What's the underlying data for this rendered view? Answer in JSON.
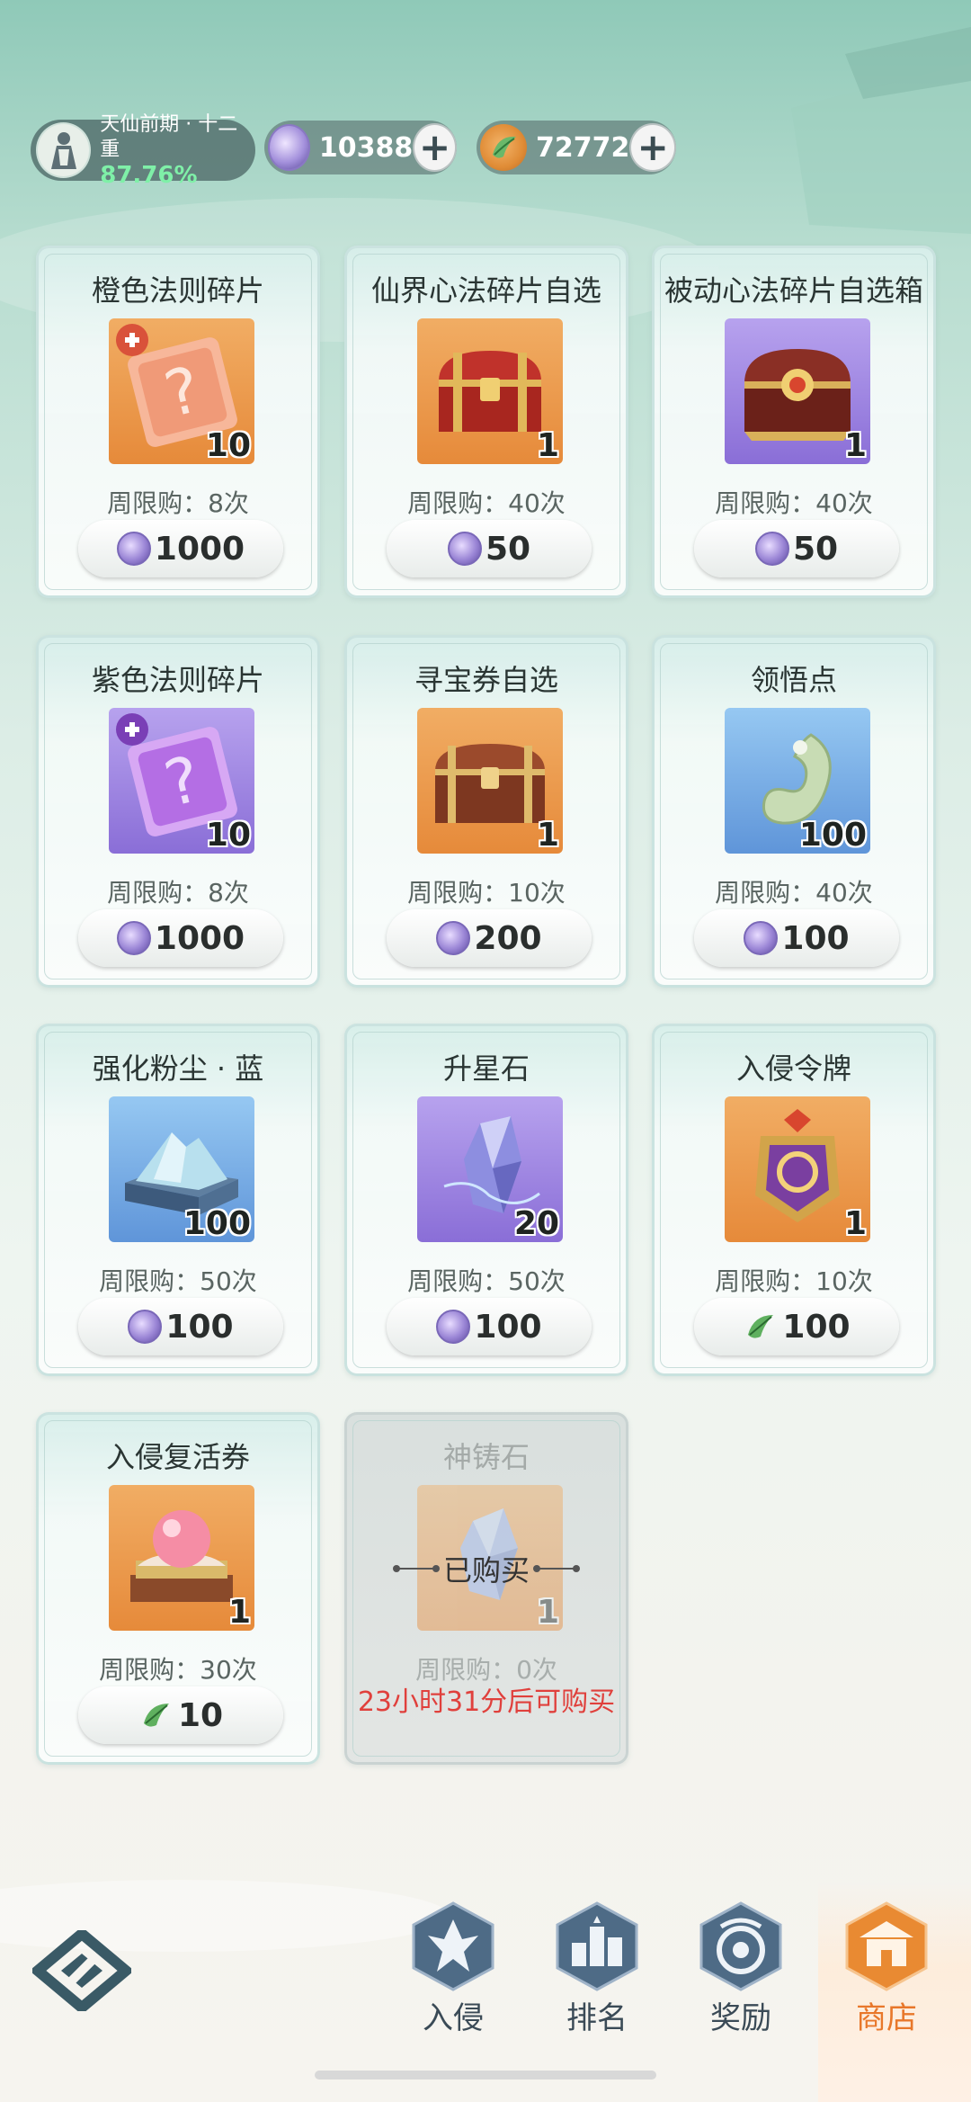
{
  "header": {
    "realm_name": "天仙前期 · 十二重",
    "realm_progress": "87.76%",
    "currencies": [
      {
        "icon": "spirit-gem-icon",
        "value": "10388"
      },
      {
        "icon": "jade-leaf-icon",
        "value": "72772"
      }
    ]
  },
  "items": [
    {
      "name": "橙色法则碎片",
      "count": "10",
      "limit": "周限购：8次",
      "price": "1000",
      "currency": "gem",
      "bg": "orange",
      "icon": "orange-rule-fragment-icon"
    },
    {
      "name": "仙界心法碎片自选",
      "count": "1",
      "limit": "周限购：40次",
      "price": "50",
      "currency": "gem",
      "bg": "orange",
      "icon": "red-treasure-chest-icon"
    },
    {
      "name": "被动心法碎片自选箱",
      "count": "1",
      "limit": "周限购：40次",
      "price": "50",
      "currency": "gem",
      "bg": "purple",
      "icon": "ornate-chest-icon"
    },
    {
      "name": "紫色法则碎片",
      "count": "10",
      "limit": "周限购：8次",
      "price": "1000",
      "currency": "gem",
      "bg": "purple",
      "icon": "purple-rule-fragment-icon"
    },
    {
      "name": "寻宝券自选",
      "count": "1",
      "limit": "周限购：10次",
      "price": "200",
      "currency": "gem",
      "bg": "orange",
      "icon": "wooden-chest-icon"
    },
    {
      "name": "领悟点",
      "count": "100",
      "limit": "周限购：40次",
      "price": "100",
      "currency": "gem",
      "bg": "blue",
      "icon": "jade-pendant-icon"
    },
    {
      "name": "强化粉尘 · 蓝",
      "count": "100",
      "limit": "周限购：50次",
      "price": "100",
      "currency": "gem",
      "bg": "blue",
      "icon": "dust-box-icon"
    },
    {
      "name": "升星石",
      "count": "20",
      "limit": "周限购：50次",
      "price": "100",
      "currency": "gem",
      "bg": "purple",
      "icon": "star-crystal-icon"
    },
    {
      "name": "入侵令牌",
      "count": "1",
      "limit": "周限购：10次",
      "price": "100",
      "currency": "leaf",
      "bg": "orange",
      "icon": "invasion-token-icon"
    },
    {
      "name": "入侵复活券",
      "count": "1",
      "limit": "周限购：30次",
      "price": "10",
      "currency": "leaf",
      "bg": "orange",
      "icon": "revive-orb-icon"
    }
  ],
  "sold_item": {
    "name": "神铸石",
    "count": "1",
    "sold_label": "已购买",
    "limit": "周限购：0次",
    "restock": "23小时31分后可购买"
  },
  "nav": [
    {
      "label": "入侵",
      "icon": "invasion-icon"
    },
    {
      "label": "排名",
      "icon": "ranking-icon"
    },
    {
      "label": "奖励",
      "icon": "reward-icon"
    },
    {
      "label": "商店",
      "icon": "shop-icon",
      "active": true
    }
  ],
  "colors": {
    "accent_orange": "#e8772a",
    "restock_red": "#e0403c",
    "gem_purple": "#9b86d6"
  }
}
